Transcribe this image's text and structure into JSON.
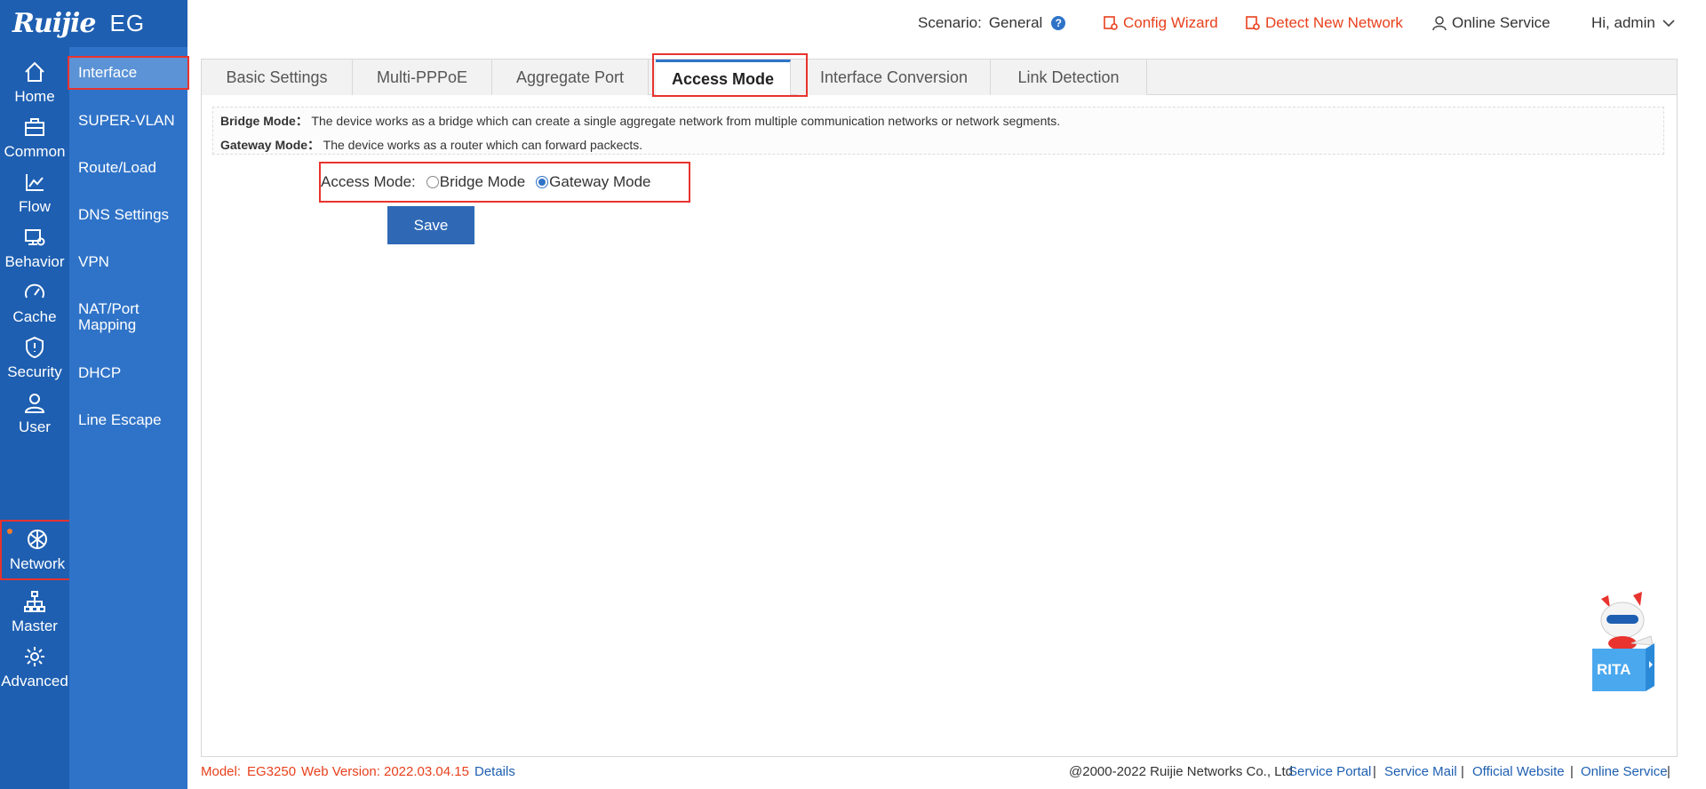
{
  "brand": {
    "logo": "Ruijie",
    "product": "EG"
  },
  "header": {
    "scenario_label": "Scenario:",
    "scenario_value": "General",
    "help_icon": "?",
    "config_wizard": "Config Wizard",
    "detect_network": "Detect New Network",
    "online_service": "Online Service",
    "user": "Hi, admin"
  },
  "main_nav": [
    {
      "label": "Home",
      "icon": "home-icon"
    },
    {
      "label": "Common",
      "icon": "briefcase-icon"
    },
    {
      "label": "Flow",
      "icon": "line-chart-icon"
    },
    {
      "label": "Behavior",
      "icon": "monitor-icon"
    },
    {
      "label": "Cache",
      "icon": "speedometer-icon"
    },
    {
      "label": "Security",
      "icon": "shield-icon"
    },
    {
      "label": "User",
      "icon": "user-icon"
    },
    {
      "label": "Network",
      "icon": "globe-icon",
      "active": true
    },
    {
      "label": "Master",
      "icon": "sitemap-icon"
    },
    {
      "label": "Advanced",
      "icon": "gear-icon"
    }
  ],
  "sub_nav": [
    {
      "label": "Interface",
      "active": true
    },
    {
      "label": "SUPER-VLAN"
    },
    {
      "label": "Route/Load"
    },
    {
      "label": "DNS Settings"
    },
    {
      "label": "VPN"
    },
    {
      "label": "NAT/Port Mapping"
    },
    {
      "label": "DHCP"
    },
    {
      "label": "Line Escape"
    }
  ],
  "tabs": [
    {
      "label": "Basic Settings"
    },
    {
      "label": "Multi-PPPoE"
    },
    {
      "label": "Aggregate Port"
    },
    {
      "label": "Access Mode",
      "active": true
    },
    {
      "label": "Interface Conversion"
    },
    {
      "label": "Link Detection"
    }
  ],
  "info": {
    "bridge_title": "Bridge Mode：",
    "bridge_desc": "The device works as a bridge which can create a single aggregate network from multiple communication networks or network segments.",
    "gateway_title": "Gateway Mode：",
    "gateway_desc": "The device works as a router which can forward packects."
  },
  "access_mode": {
    "label": "Access Mode:",
    "options": [
      "Bridge Mode",
      "Gateway Mode"
    ],
    "selected": "Gateway Mode"
  },
  "save_label": "Save",
  "rita_label": "RITA",
  "footer": {
    "model_label": "Model:",
    "model_value": "EG3250",
    "web_version_label": "Web Version:",
    "web_version_value": "2022.03.04.15",
    "details": "Details",
    "copyright": "@2000-2022 Ruijie Networks Co., Ltd",
    "links": [
      "Service Portal",
      "Service Mail",
      "Official Website",
      "Online Service"
    ],
    "separator": "|"
  },
  "colors": {
    "nav_bg": "#1e5fb1",
    "subnav_bg": "#2f73c8",
    "accent_red": "#e8401c",
    "highlight": "#e8332e",
    "button": "#2f69b6"
  }
}
